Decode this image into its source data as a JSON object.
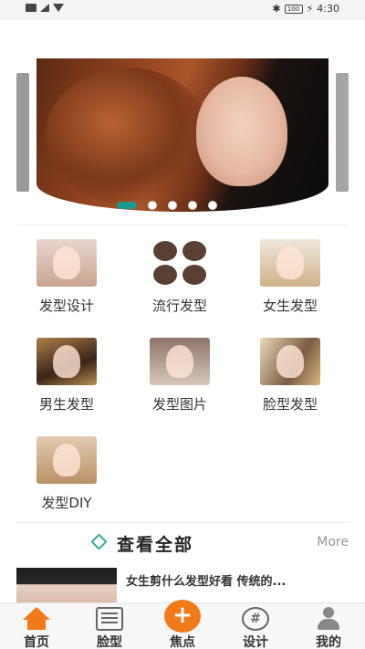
{
  "status_bar": {
    "time": "4:30",
    "battery": "100"
  },
  "banner": {
    "slide_count": 5,
    "active_index": 0
  },
  "grid": {
    "items": [
      {
        "label": "发型设计"
      },
      {
        "label": "流行发型"
      },
      {
        "label": "女生发型"
      },
      {
        "label": "男生发型"
      },
      {
        "label": "发型图片"
      },
      {
        "label": "脸型发型"
      },
      {
        "label": "发型DIY"
      }
    ]
  },
  "section": {
    "title": "查看全部",
    "more": "More"
  },
  "article": {
    "title": "女生剪什么发型好看 传统的..."
  },
  "bottom_nav": {
    "items": [
      {
        "label": "首页",
        "icon": "home-icon"
      },
      {
        "label": "脸型",
        "icon": "face-shape-icon"
      },
      {
        "label": "焦点",
        "icon": "plus-icon",
        "glyph": "+"
      },
      {
        "label": "设计",
        "icon": "design-icon",
        "glyph": "#"
      },
      {
        "label": "我的",
        "icon": "user-icon"
      }
    ]
  },
  "colors": {
    "accent": "#f07a1a",
    "teal": "#1a9a8a"
  }
}
